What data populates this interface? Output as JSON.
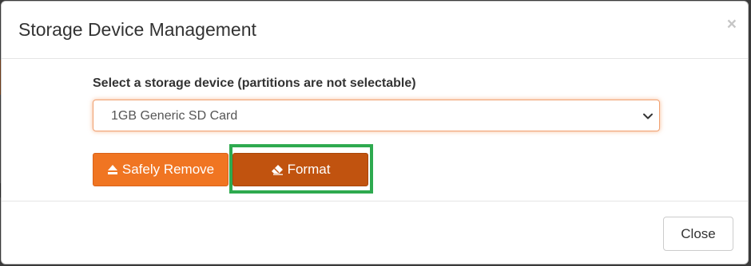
{
  "modal": {
    "title": "Storage Device Management",
    "close_glyph": "×"
  },
  "body": {
    "device_label": "Select a storage device (partitions are not selectable)",
    "device_select": {
      "value": "1GB Generic SD Card"
    },
    "buttons": {
      "safely_remove": {
        "label": "Safely Remove",
        "icon": "eject-icon"
      },
      "format": {
        "label": "Format",
        "icon": "eraser-icon"
      }
    }
  },
  "footer": {
    "close_label": "Close"
  },
  "colors": {
    "accent": "#f07522",
    "accent_dark": "#c1530f",
    "highlight": "#2eaa4f"
  }
}
